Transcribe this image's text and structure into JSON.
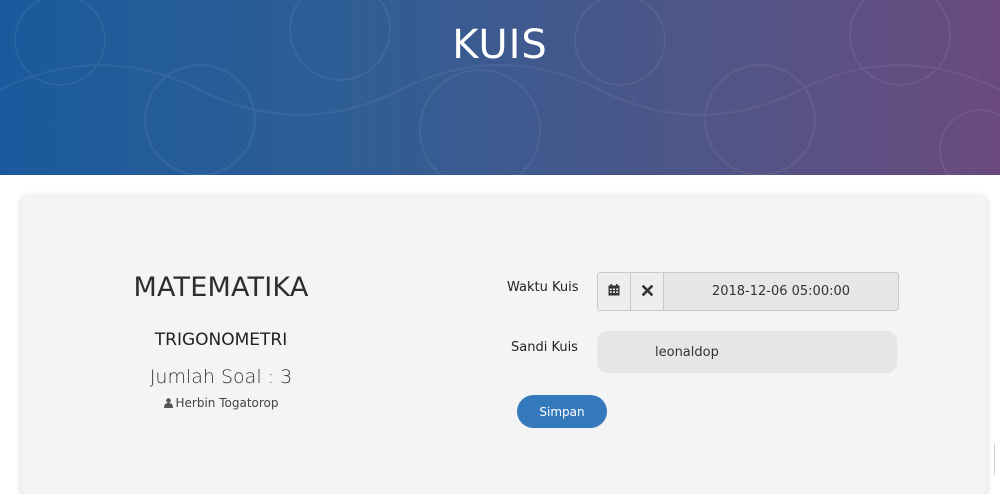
{
  "header": {
    "title": "KUIS"
  },
  "quiz": {
    "subject": "MATEMATIKA",
    "topic": "TRIGONOMETRI",
    "question_count": "Jumlah Soal : 3",
    "author": "Herbin Togatorop"
  },
  "form": {
    "time_label": "Waktu Kuis",
    "time_value": "2018-12-06 05:00:00",
    "password_label": "Sandi Kuis",
    "password_value": "leonaldop",
    "save_label": "Simpan"
  },
  "icons": {
    "calendar": "calendar-icon",
    "clear": "close-icon",
    "author": "user-icon"
  },
  "colors": {
    "header_gradient_start": "#1a5a9c",
    "header_gradient_end": "#6a4a7e",
    "button": "#3579bd",
    "card_background": "#f4f4f4"
  }
}
